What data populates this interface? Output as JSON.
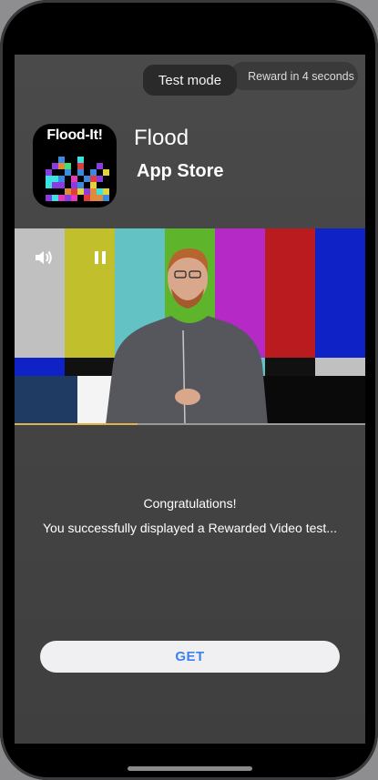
{
  "ad": {
    "test_mode_label": "Test mode",
    "reward_countdown": "Reward in 4 seconds",
    "app_icon_text": "Flood-It!",
    "app_name": "Flood",
    "store_name": "App Store",
    "video_progress": 0.35,
    "congrats_title": "Congratulations!",
    "congrats_message": "You successfully displayed a Rewarded Video test...",
    "cta_label": "GET"
  },
  "icons": {
    "volume": "speaker-icon",
    "pause": "pause-icon"
  },
  "colors": {
    "background": "#444444",
    "cta_text": "#3b82f0",
    "progress": "#e0b34a",
    "test_bars": [
      "#c0c0c0",
      "#c1bf2c",
      "#62c2c4",
      "#5eb52c",
      "#b52ac6",
      "#b91b1f",
      "#0e22c5"
    ]
  }
}
